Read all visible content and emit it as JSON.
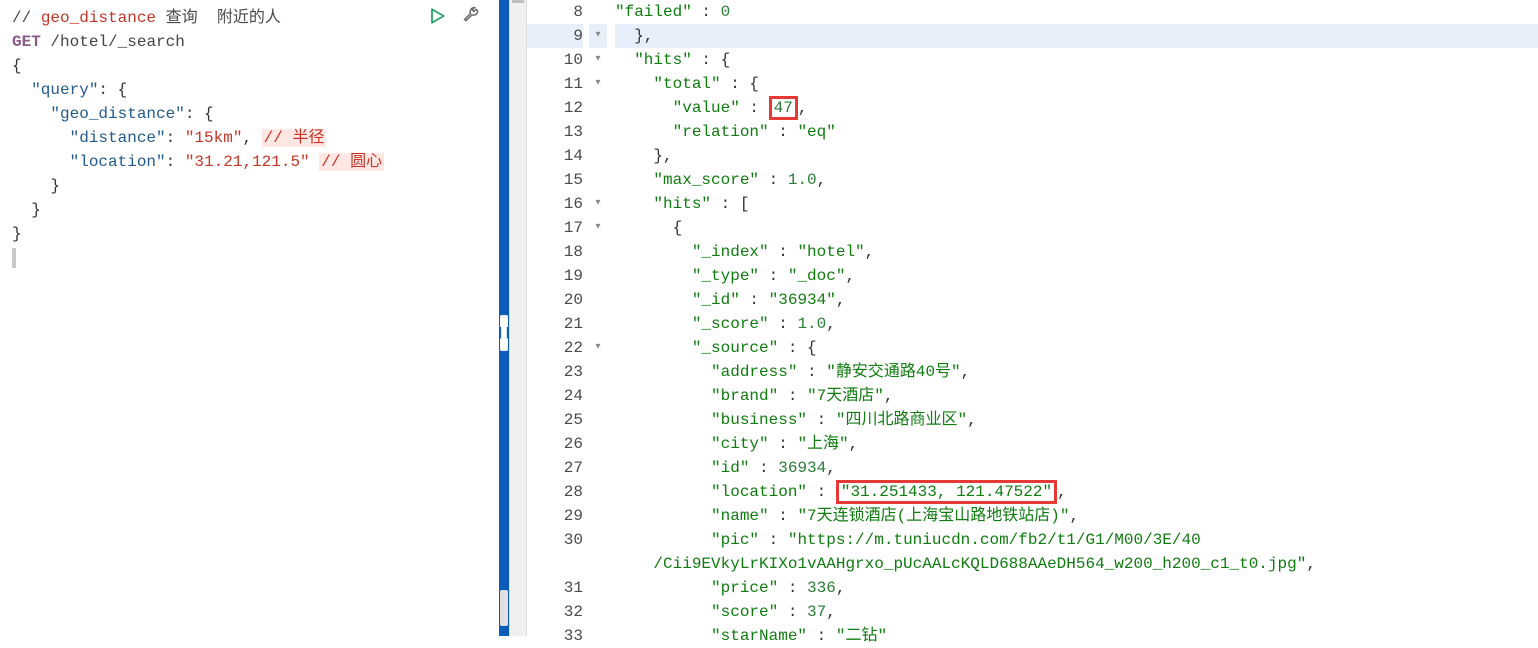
{
  "left": {
    "comment_prefix": "//",
    "comment_id": "geo_distance",
    "comment_rest": "查询  附近的人",
    "method": "GET",
    "path": "/hotel/_search",
    "l3": "{",
    "l4_key": "\"query\"",
    "l4_rest": ": {",
    "l5_key": "\"geo_distance\"",
    "l5_rest": ": {",
    "l6_key": "\"distance\"",
    "l6_val": "\"15km\"",
    "l6_com": "// 半径",
    "l7_key": "\"location\"",
    "l7_val": "\"31.21,121.5\"",
    "l7_com": "// 圆心",
    "l8": "    }",
    "l9": "  }",
    "l10": "}"
  },
  "right": {
    "gutter": [
      "8",
      "9",
      "10",
      "11",
      "12",
      "13",
      "14",
      "15",
      "16",
      "17",
      "18",
      "19",
      "20",
      "21",
      "22",
      "23",
      "24",
      "25",
      "26",
      "27",
      "28",
      "29",
      "30",
      "",
      "31",
      "32",
      "33"
    ],
    "fold": [
      "",
      "▾",
      "▾",
      "▾",
      "",
      "",
      "",
      "",
      "▾",
      "▾",
      "",
      "",
      "",
      "",
      "▾",
      "",
      "",
      "",
      "",
      "",
      "",
      "",
      "",
      "",
      "",
      "",
      ""
    ],
    "l8a": "      \"failed\" : 0",
    "l9": "  },",
    "l10_k": "\"hits\"",
    "l10_r": " : {",
    "l11_k": "\"total\"",
    "l11_r": " : {",
    "l12_k": "\"value\"",
    "l12_v": "47",
    "l12_after": ",",
    "l13_k": "\"relation\"",
    "l13_v": "\"eq\"",
    "l14": "    },",
    "l15_k": "\"max_score\"",
    "l15_v": "1.0",
    "l15_r": ",",
    "l16_k": "\"hits\"",
    "l16_r": " : [",
    "l17": "      {",
    "l18_k": "\"_index\"",
    "l18_v": "\"hotel\"",
    "l18_r": ",",
    "l19_k": "\"_type\"",
    "l19_v": "\"_doc\"",
    "l19_r": ",",
    "l20_k": "\"_id\"",
    "l20_v": "\"36934\"",
    "l20_r": ",",
    "l21_k": "\"_score\"",
    "l21_v": "1.0",
    "l21_r": ",",
    "l22_k": "\"_source\"",
    "l22_r": " : {",
    "l23_k": "\"address\"",
    "l23_v": "\"静安交通路40号\"",
    "l23_r": ",",
    "l24_k": "\"brand\"",
    "l24_v": "\"7天酒店\"",
    "l24_r": ",",
    "l25_k": "\"business\"",
    "l25_v": "\"四川北路商业区\"",
    "l25_r": ",",
    "l26_k": "\"city\"",
    "l26_v": "\"上海\"",
    "l26_r": ",",
    "l27_k": "\"id\"",
    "l27_v": "36934",
    "l27_r": ",",
    "l28_k": "\"location\"",
    "l28_v": "\"31.251433, 121.47522\"",
    "l28_r": ",",
    "l29_k": "\"name\"",
    "l29_v": "\"7天连锁酒店(上海宝山路地铁站店)\"",
    "l29_r": ",",
    "l30_k": "\"pic\"",
    "l30_v1": "\"https://m.tuniucdn.com/fb2/t1/G1/M00/3E/40",
    "l30_v2": "    /Cii9EVkyLrKIXo1vAAHgrxo_pUcAALcKQLD688AAeDH564_w200_h200_c1_t0.jpg\"",
    "l30_r": ",",
    "l31_k": "\"price\"",
    "l31_v": "336",
    "l31_r": ",",
    "l32_k": "\"score\"",
    "l32_v": "37",
    "l32_r": ",",
    "l33_k": "\"starName\"",
    "l33_v": "\"二钻\""
  }
}
